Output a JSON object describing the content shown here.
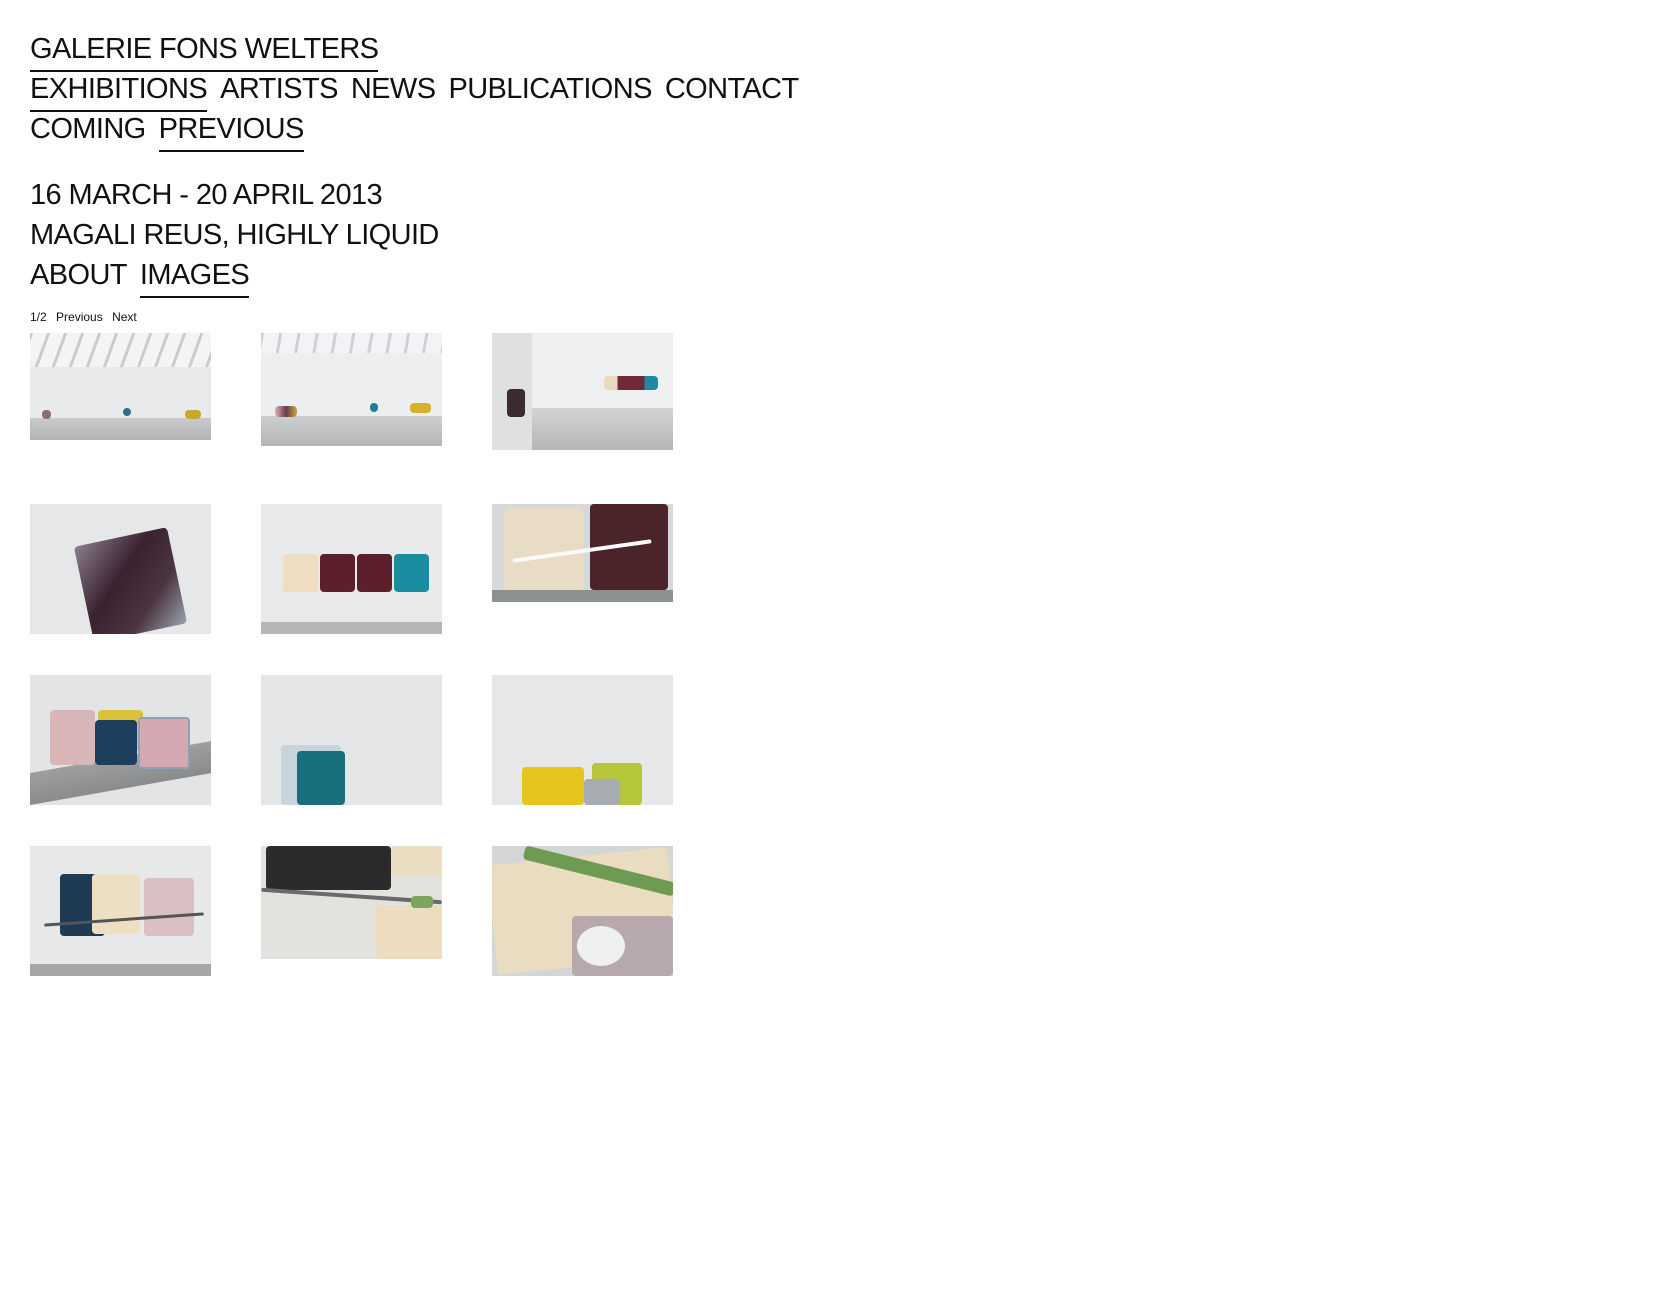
{
  "header": {
    "gallery_name": "GALERIE FONS WELTERS",
    "nav": [
      "EXHIBITIONS",
      "ARTISTS",
      "NEWS",
      "PUBLICATIONS",
      "CONTACT"
    ],
    "subnav": [
      "COMING",
      "PREVIOUS"
    ]
  },
  "exhibition": {
    "dates": "16 MARCH - 20 APRIL 2013",
    "title": "MAGALI REUS, HIGHLY LIQUID",
    "tabs": [
      "ABOUT",
      "IMAGES"
    ]
  },
  "pager": {
    "page": "1/2",
    "previous": "Previous",
    "next": "Next"
  },
  "thumbnails": [
    "gallery-view-skylight-icon",
    "gallery-view-wall-icon",
    "corner-view-bench-icon",
    "wrapped-seat-icon",
    "four-seat-bench-icon",
    "seat-detail-icon",
    "pastel-seats-plastic-icon",
    "teal-seat-plastic-icon",
    "yellow-green-seats-icon",
    "three-seat-bench-rod-icon",
    "black-seat-rod-icon",
    "cream-seat-green-bar-icon"
  ]
}
